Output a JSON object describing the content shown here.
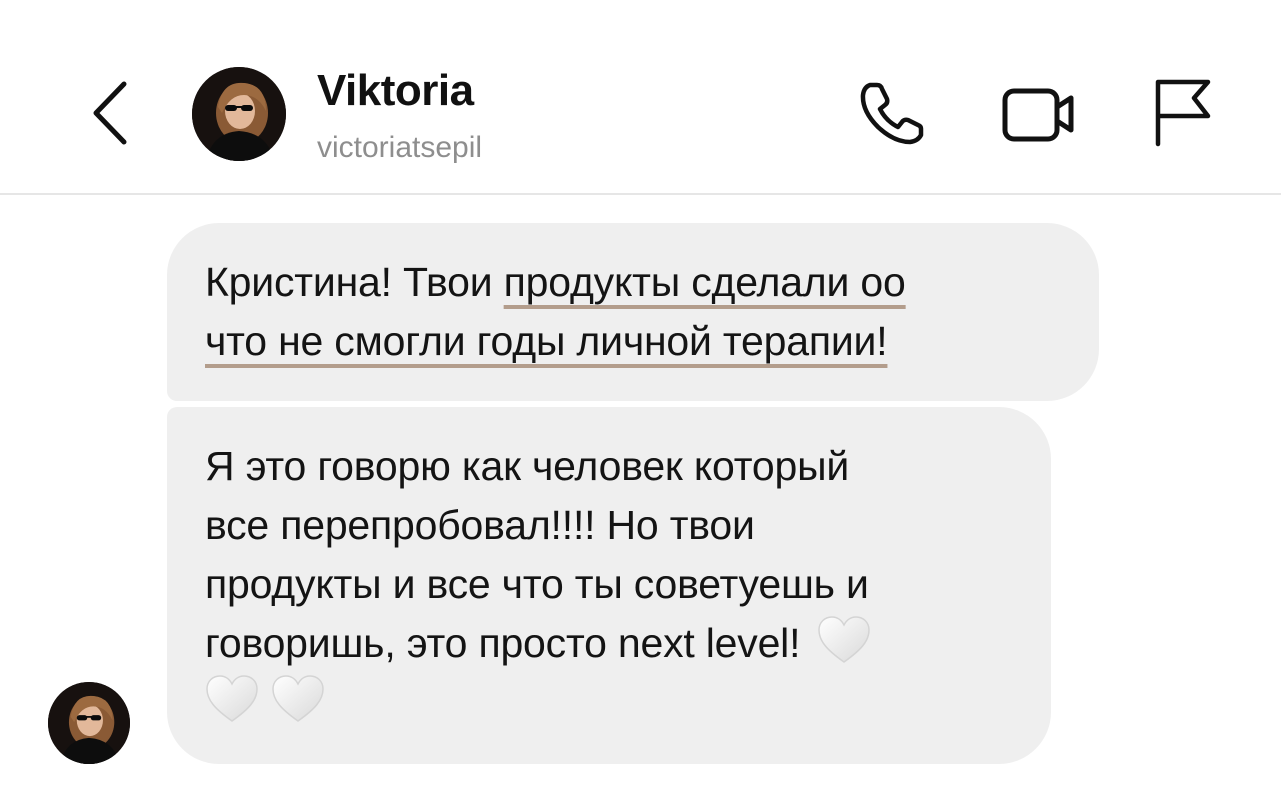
{
  "header": {
    "name": "Viktoria",
    "username": "victoriatsepil",
    "icons": {
      "back": "chevron-left-icon",
      "call": "phone-icon",
      "video": "video-camera-icon",
      "report": "flag-icon"
    }
  },
  "messages": [
    {
      "parts": [
        {
          "text": "Кристина! Твои ",
          "underline": false
        },
        {
          "text": "продукты сделали оо",
          "underline": true
        },
        {
          "text": "\n",
          "underline": false
        },
        {
          "text": "что не смогли годы личной терапии!",
          "underline": true
        }
      ]
    },
    {
      "text": "Я это говорю как человек который все перепробовал!!!! Но твои продукты и все что ты советуешь и говоришь, это просто next level!",
      "lines": [
        "Я это говорю как человек который",
        "все перепробовал!!!! Но твои",
        "продукты и все что ты советуешь и",
        "говоришь, это просто next level!"
      ],
      "reactions": [
        "white-heart-icon",
        "white-heart-icon",
        "white-heart-icon"
      ]
    }
  ],
  "colors": {
    "bubble": "#efefef",
    "underline": "#b39d8c",
    "secondary_text": "#8e8e8e",
    "divider": "#e6e6e6"
  }
}
